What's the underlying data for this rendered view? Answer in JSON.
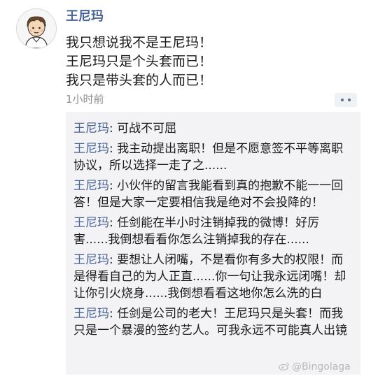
{
  "post": {
    "author": "王尼玛",
    "lines": [
      "我只想说我不是王尼玛！",
      "王尼玛只是个头套而已！",
      "我只是带头套的人而已！"
    ],
    "time": "1小时前"
  },
  "comments": [
    {
      "name": "王尼玛",
      "sep": ": ",
      "text": "可战不可屈"
    },
    {
      "name": "王尼玛",
      "sep": ": ",
      "text": "我主动提出离职！但是不愿意签不平等离职协议，所以选择一走了之......"
    },
    {
      "name": "王尼玛",
      "sep": ": ",
      "text": "小伙伴的留言我能看到真的抱歉不能一一回答！但是大家一定要相信我是绝对不会投降的！"
    },
    {
      "name": "王尼玛",
      "sep": ": ",
      "text": "任剑能在半小时注销掉我的微博！好厉害......我倒想看看你怎么注销掉我的存在......"
    },
    {
      "name": "王尼玛",
      "sep": ": ",
      "text": "要想让人闭嘴，不是看你有多大的权限！而是得看自己的为人正直......你一句让我永远闭嘴！却让你引火烧身......我倒想看看这地你怎么洗的白"
    },
    {
      "name": "王尼玛",
      "sep": ": ",
      "text": "任剑是公司的老大！王尼玛只是头套！而我只是一个暴漫的签约艺人。可我永远不可能真人出镜"
    }
  ],
  "watermark": "@Bingolaga",
  "icons": {
    "avatar": "avatar-cartoon-icon",
    "comment": "comment-icon",
    "watermark": "weibo-logo-icon"
  },
  "colors": {
    "name": "#4a6496",
    "text": "#1a1a1a",
    "time": "#8c8c8c",
    "comment_bg": "#f3f3f5"
  }
}
